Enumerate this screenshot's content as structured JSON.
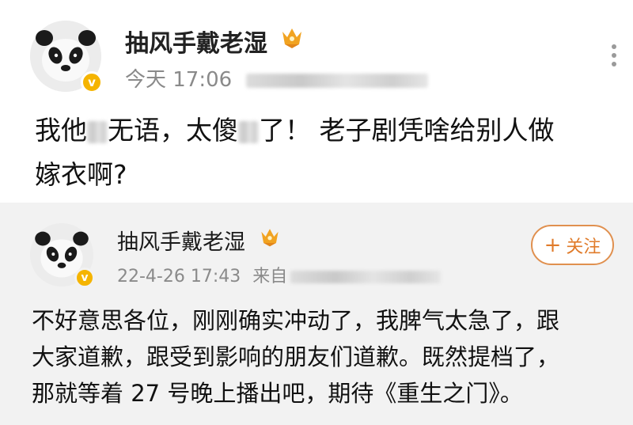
{
  "post": {
    "user_name": "抽风手戴老湿",
    "time": "今天 17:06",
    "text_line1_a": "我他",
    "text_line1_b": "无语，太傻",
    "text_line1_c": "了！ 老子剧凭啥给别人做",
    "text_line2": "嫁衣啊?"
  },
  "repost": {
    "user_name": "抽风手戴老湿",
    "time": "22-4-26 17:43",
    "source_prefix": "来自",
    "follow_label": "关注",
    "follow_plus": "+",
    "text_line1": "不好意思各位，刚刚确实冲动了，我脾气太急了，跟",
    "text_line2": "大家道歉，跟受到影响的朋友们道歉。既然提档了，",
    "text_line3": "那就等着 27 号晚上播出吧，期待《重生之门》。"
  },
  "badges": {
    "verified_mark": "v"
  },
  "icons": {
    "more": "more-vertical-icon",
    "crown": "crown-badge-icon",
    "avatar": "panda-avatar"
  },
  "colors": {
    "accent": "#e07b2a",
    "verified": "#f5b400",
    "repost_bg": "#f2f2f2",
    "meta": "#8a8a8a"
  }
}
